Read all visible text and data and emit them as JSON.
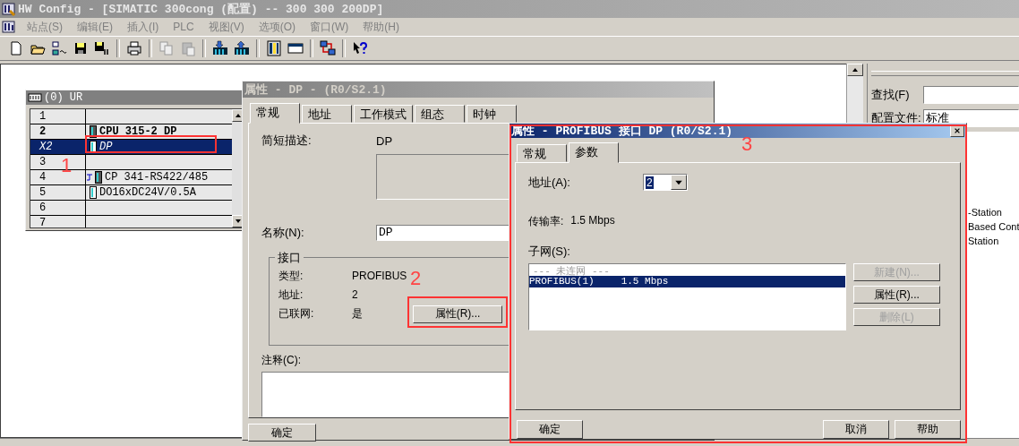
{
  "app": {
    "title": "HW Config - [SIMATIC 300cong (配置) -- 300 300 200DP]",
    "menu": [
      "站点(S)",
      "编辑(E)",
      "插入(I)",
      "PLC",
      "视图(V)",
      "选项(O)",
      "窗口(W)",
      "帮助(H)"
    ]
  },
  "rack": {
    "title": "(0) UR",
    "rows": [
      {
        "slot": "1",
        "kind": "empty",
        "selected": false
      },
      {
        "slot": "2",
        "module": "CPU 315-2 DP",
        "kind": "cpu",
        "selected": false
      },
      {
        "slot": "X2",
        "module": "DP",
        "kind": "interface",
        "selected": true
      },
      {
        "slot": "3",
        "kind": "empty",
        "selected": false
      },
      {
        "slot": "4",
        "module": "CP 341-RS422/485",
        "kind": "comm",
        "selected": false
      },
      {
        "slot": "5",
        "module": "DO16xDC24V/0.5A",
        "kind": "module",
        "selected": false
      },
      {
        "slot": "6",
        "kind": "empty",
        "selected": false
      },
      {
        "slot": "7",
        "kind": "empty",
        "selected": false
      }
    ]
  },
  "catalog": {
    "search_label": "查找(F)",
    "profile_label": "配置文件:",
    "profile_value": "标准",
    "items": [
      "-Station",
      "Based Cont",
      "Station"
    ]
  },
  "dp_dialog": {
    "title": "属性 - DP - (R0/S2.1)",
    "tabs": [
      {
        "label": "常规",
        "selected": true
      },
      {
        "label": "地址",
        "selected": false
      },
      {
        "label": "工作模式",
        "selected": false
      },
      {
        "label": "组态",
        "selected": false
      },
      {
        "label": "时钟",
        "selected": false
      }
    ],
    "short_desc_label": "简短描述:",
    "short_desc": "DP",
    "name_label": "名称(N):",
    "name_value": "DP",
    "interface_group": "接口",
    "fields": [
      {
        "label": "类型:",
        "value": "PROFIBUS"
      },
      {
        "label": "地址:",
        "value": "2"
      },
      {
        "label": "已联网:",
        "value": "是"
      }
    ],
    "properties_button": "属性(R)...",
    "comment_label": "注释(C):",
    "ok_button": "确定"
  },
  "profibus_dialog": {
    "title": "属性 - PROFIBUS 接口 DP (R0/S2.1)",
    "tabs": [
      {
        "label": "常规",
        "selected": false
      },
      {
        "label": "参数",
        "selected": true
      }
    ],
    "address_label": "地址(A):",
    "address_value": "2",
    "rate_label": "传输率:",
    "rate_value": "1.5 Mbps",
    "subnet_label": "子网(S):",
    "subnets": [
      {
        "name": "--- 未连网 ---",
        "kind": "none",
        "selected": false
      },
      {
        "name": "PROFIBUS(1)",
        "speed": "1.5 Mbps",
        "kind": "network",
        "selected": true
      }
    ],
    "side_buttons": [
      {
        "label": "新建(N)...",
        "disabled": true
      },
      {
        "label": "属性(R)...",
        "disabled": false
      },
      {
        "label": "删除(L)",
        "disabled": true
      }
    ],
    "ok_button": "确定",
    "cancel_button": "取消",
    "help_button": "帮助"
  },
  "annotations": [
    {
      "label": "1"
    },
    {
      "label": "2"
    },
    {
      "label": "3"
    }
  ]
}
